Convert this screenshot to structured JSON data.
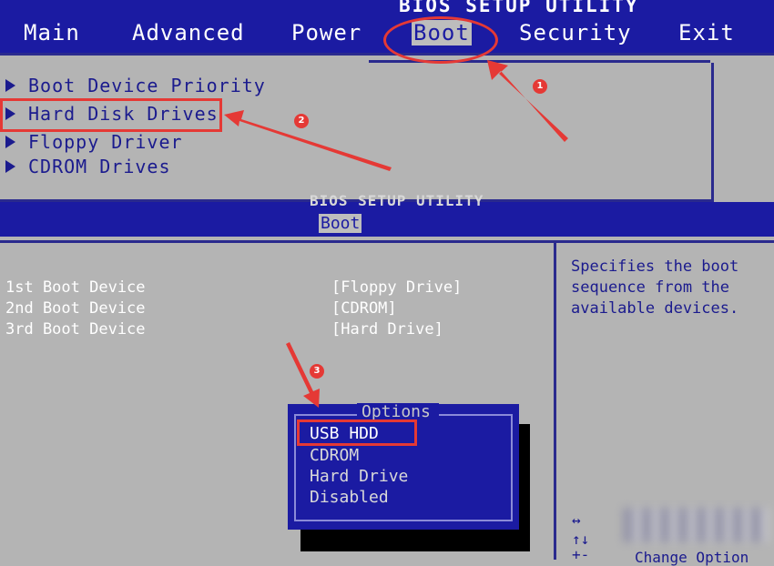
{
  "top_screen": {
    "title": "BIOS SETUP UTILITY",
    "menu": [
      "Main",
      "Advanced",
      "Power",
      "Boot",
      "Security",
      "Exit"
    ],
    "active_menu": "Boot",
    "items": [
      "Boot Device Priority",
      "Hard Disk Drives",
      "Floppy Driver",
      "CDROM Drives"
    ]
  },
  "bottom_screen": {
    "title": "BIOS SETUP UTILITY",
    "tab": "Boot",
    "boot_devices": [
      {
        "label": "1st Boot Device",
        "value": "[Floppy Drive]"
      },
      {
        "label": "2nd Boot Device",
        "value": "[CDROM]"
      },
      {
        "label": "3rd Boot Device",
        "value": "[Hard Drive]"
      }
    ],
    "help_text": "Specifies the boot sequence from the available devices.",
    "keys": [
      "↔",
      "↑↓",
      "+-"
    ],
    "key_hint_partial": "Change Option"
  },
  "options_popup": {
    "title": "Options",
    "items": [
      "USB HDD",
      "CDROM",
      "Hard Drive",
      "Disabled"
    ],
    "selected": "USB HDD"
  },
  "annotations": {
    "badges": [
      "1",
      "2",
      "3"
    ],
    "color": "#e53935"
  },
  "colors": {
    "bios_blue": "#1b1ba2",
    "bios_gray": "#b4b4b4",
    "text_dark_blue": "#1b1b8e"
  }
}
